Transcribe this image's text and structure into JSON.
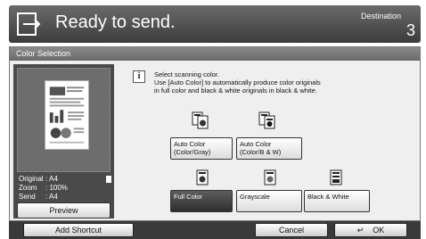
{
  "header": {
    "title": "Ready to send.",
    "destination_label": "Destination",
    "destination_count": "3"
  },
  "panel": {
    "title": "Color Selection"
  },
  "preview": {
    "original_label": "Original",
    "original_value": ": A4",
    "zoom_label": "Zoom",
    "zoom_value": ": 100%",
    "send_label": "Send",
    "send_value": ": A4",
    "button_label": "Preview"
  },
  "message": [
    "Select scanning color.",
    "Use [Auto Color] to automatically produce color originals",
    "in full color and black & white originals in black & white."
  ],
  "options": {
    "auto_color_gray": [
      "Auto Color",
      "(Color/Gray)"
    ],
    "auto_color_bw": [
      "Auto Color",
      "(Color/B & W)"
    ],
    "full_color": "Full Color",
    "grayscale": "Grayscale",
    "black_white": "Black & White",
    "selected": "Full Color"
  },
  "footer": {
    "add_shortcut": "Add Shortcut",
    "cancel": "Cancel",
    "ok": "OK"
  }
}
